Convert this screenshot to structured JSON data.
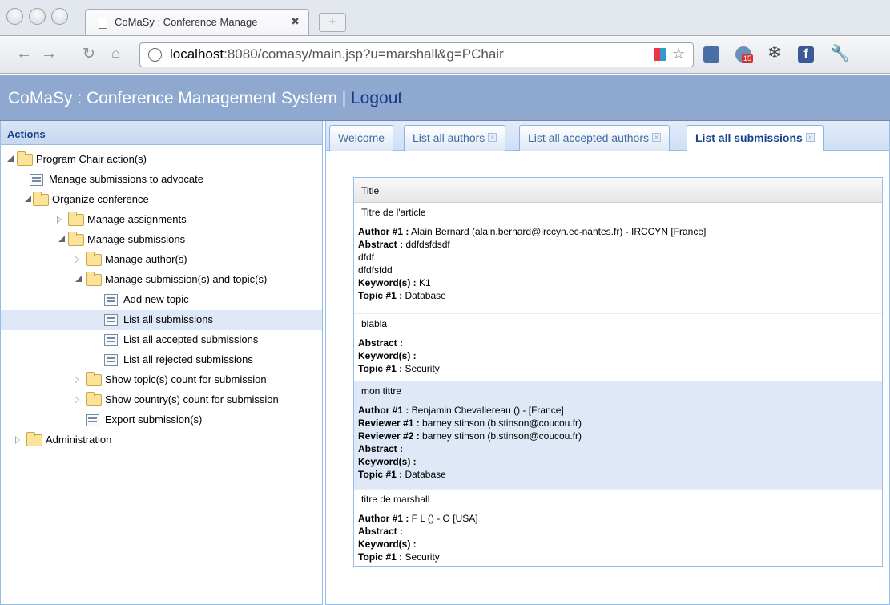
{
  "browser": {
    "tab_title": "CoMaSy : Conference Manage",
    "tab_close": "✖",
    "newtab": "+",
    "url_host": "localhost",
    "url_path": ":8080/comasy/main.jsp?u=marshall&g=PChair",
    "toolbar_badge": "15"
  },
  "app": {
    "title": "CoMaSy : Conference Management System | ",
    "logout": "Logout"
  },
  "left": {
    "header": "Actions",
    "tree": [
      {
        "label": "Program Chair action(s)"
      },
      {
        "label": "Manage submissions to advocate"
      },
      {
        "label": "Organize conference"
      },
      {
        "label": "Manage assignments"
      },
      {
        "label": "Manage submissions"
      },
      {
        "label": "Manage author(s)"
      },
      {
        "label": "Manage submission(s) and topic(s)"
      },
      {
        "label": "Add new topic"
      },
      {
        "label": "List all submissions"
      },
      {
        "label": "List all accepted submissions"
      },
      {
        "label": "List all rejected submissions"
      },
      {
        "label": "Show topic(s) count for submission"
      },
      {
        "label": "Show country(s) count for submission"
      },
      {
        "label": "Export submission(s)"
      },
      {
        "label": "Administration"
      }
    ]
  },
  "tabs": [
    {
      "label": "Welcome"
    },
    {
      "label": "List all authors"
    },
    {
      "label": "List all accepted authors"
    },
    {
      "label": "List all submissions"
    }
  ],
  "grid": {
    "column": "Title",
    "rows": [
      {
        "title": "Titre de l'article",
        "lines": [
          {
            "k": "Author #1 :",
            "v": " Alain Bernard (alain.bernard@irccyn.ec-nantes.fr) - IRCCYN [France]"
          },
          {
            "k": "Abstract :",
            "v": " ddfdsfdsdf"
          },
          {
            "k": "",
            "v": "dfdf"
          },
          {
            "k": "",
            "v": "dfdfsfdd"
          },
          {
            "k": "Keyword(s) :",
            "v": " K1"
          },
          {
            "k": "Topic #1 :",
            "v": " Database"
          }
        ]
      },
      {
        "title": "blabla",
        "lines": [
          {
            "k": "Abstract :",
            "v": ""
          },
          {
            "k": "Keyword(s) :",
            "v": ""
          },
          {
            "k": "Topic #1 :",
            "v": " Security"
          }
        ]
      },
      {
        "title": "mon tittre",
        "lines": [
          {
            "k": "Author #1 :",
            "v": " Benjamin Chevallereau () - [France]"
          },
          {
            "k": "Reviewer #1 :",
            "v": " barney stinson (b.stinson@coucou.fr)"
          },
          {
            "k": "Reviewer #2 :",
            "v": " barney stinson (b.stinson@coucou.fr)"
          },
          {
            "k": "Abstract :",
            "v": ""
          },
          {
            "k": "Keyword(s) :",
            "v": ""
          },
          {
            "k": "Topic #1 :",
            "v": " Database"
          }
        ]
      },
      {
        "title": "titre de marshall",
        "lines": [
          {
            "k": "Author #1 :",
            "v": " F L () - O [USA]"
          },
          {
            "k": "Abstract :",
            "v": ""
          },
          {
            "k": "Keyword(s) :",
            "v": ""
          },
          {
            "k": "Topic #1 :",
            "v": " Security"
          }
        ]
      }
    ]
  }
}
